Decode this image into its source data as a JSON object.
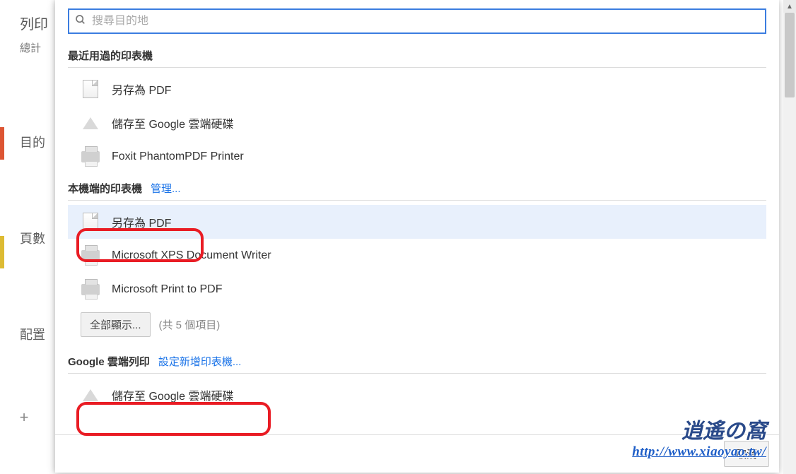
{
  "left_panel": {
    "title": "列印",
    "subtitle": "總計",
    "items": [
      "目的",
      "頁數",
      "配置"
    ]
  },
  "search": {
    "placeholder": "搜尋目的地"
  },
  "sections": {
    "recent": {
      "heading": "最近用過的印表機",
      "items": [
        {
          "label": "另存為 PDF",
          "icon": "doc"
        },
        {
          "label": "儲存至 Google 雲端硬碟",
          "icon": "drive"
        },
        {
          "label": "Foxit PhantomPDF Printer",
          "icon": "printer"
        }
      ]
    },
    "local": {
      "heading": "本機端的印表機",
      "link": "管理...",
      "items": [
        {
          "label": "另存為 PDF",
          "icon": "doc",
          "selected": true
        },
        {
          "label": "Microsoft XPS Document Writer",
          "icon": "printer"
        },
        {
          "label": "Microsoft Print to PDF",
          "icon": "printer"
        }
      ],
      "show_all": "全部顯示...",
      "count_text": "(共 5 個項目)"
    },
    "cloud": {
      "heading": "Google 雲端列印",
      "link": "設定新增印表機...",
      "items": [
        {
          "label": "儲存至 Google 雲端硬碟",
          "icon": "drive"
        }
      ]
    }
  },
  "footer": {
    "cancel": "取消"
  },
  "watermark": {
    "title": "逍遙の窩",
    "url": "http://www.xiaoyao.tw/"
  }
}
